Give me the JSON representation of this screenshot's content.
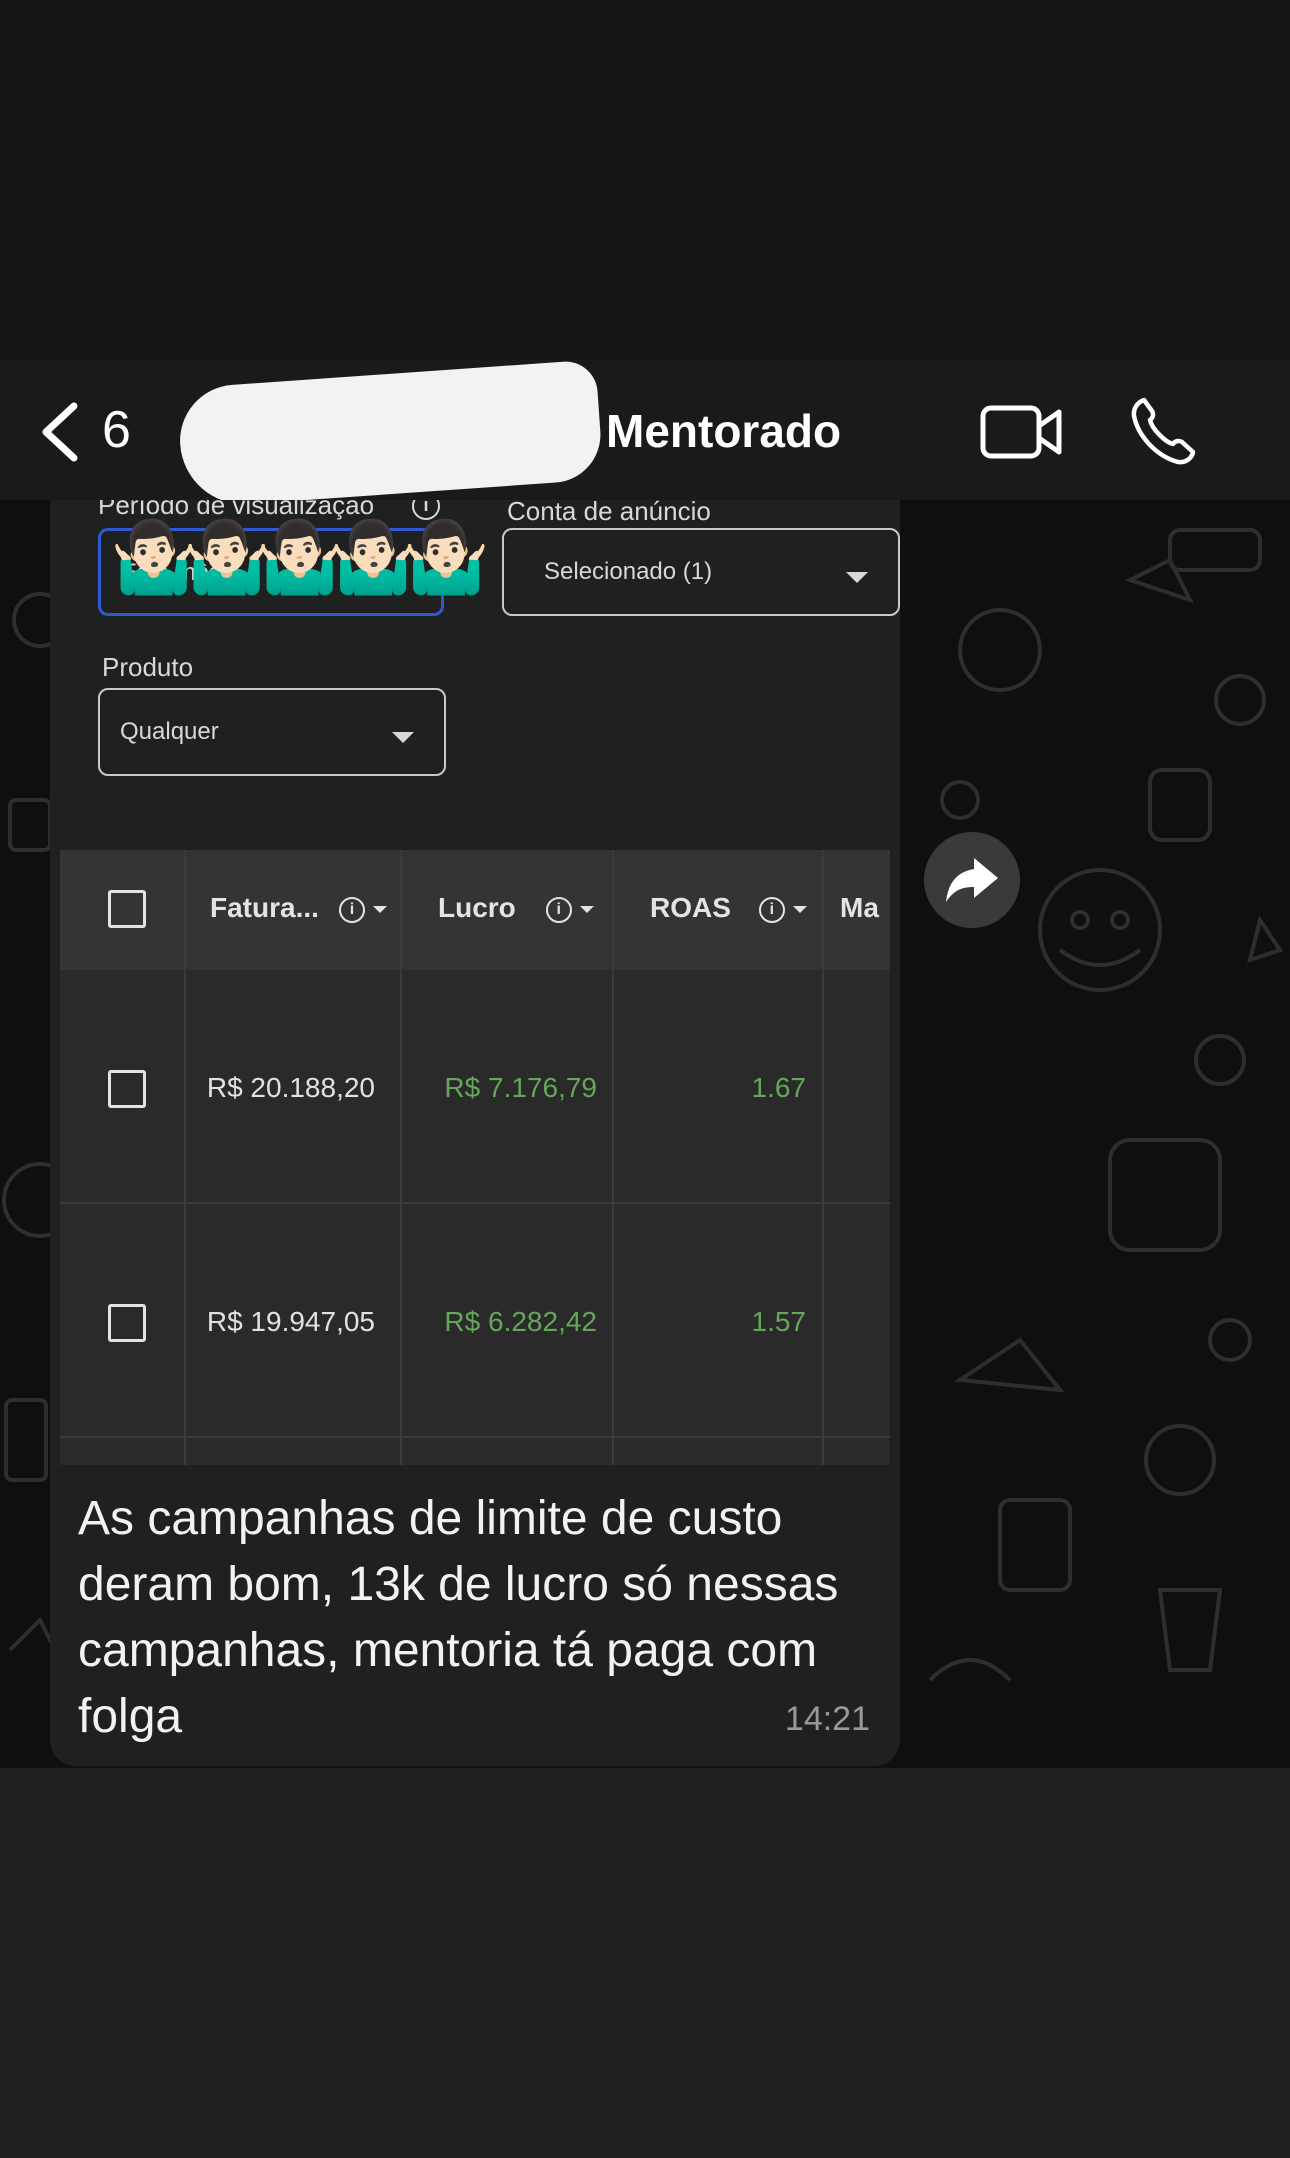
{
  "header": {
    "back_count": "6",
    "contact_name": "Mentorado"
  },
  "screenshot": {
    "period_label": "Período de visualização",
    "period_value": "Este mês",
    "account_label": "Conta de anúncio",
    "account_value": "Selecionado (1)",
    "product_label": "Produto",
    "product_value": "Qualquer",
    "emojis": "🤷🏻‍♂️🤷🏻‍♂️🤷🏻‍♂️🤷🏻‍♂️🤷🏻‍♂️",
    "table": {
      "headers": [
        "Fatura...",
        "Lucro",
        "ROAS",
        "Ma"
      ],
      "rows": [
        {
          "faturamento": "R$ 20.188,20",
          "lucro": "R$ 7.176,79",
          "roas": "1.67"
        },
        {
          "faturamento": "R$ 19.947,05",
          "lucro": "R$ 6.282,42",
          "roas": "1.57"
        }
      ]
    }
  },
  "message": {
    "text": "As campanhas de limite de custo deram bom, 13k de lucro só nessas campanhas, mentoria tá paga com folga",
    "time": "14:21"
  },
  "colors": {
    "green_value": "#66a65a",
    "bubble": "#1f2020",
    "header": "#1a1a1a"
  }
}
